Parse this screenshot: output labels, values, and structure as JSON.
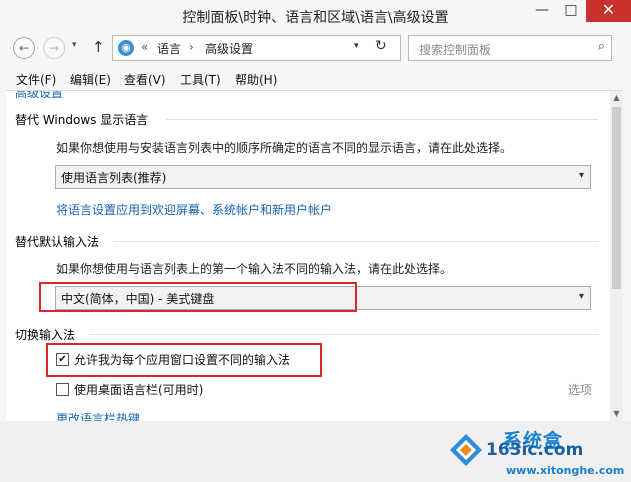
{
  "window": {
    "title": "控制面板\\时钟、语言和区域\\语言\\高级设置",
    "minimize": "—",
    "maximize": "□",
    "close": "✕"
  },
  "nav": {
    "back": "←",
    "forward": "→",
    "recent": "▾",
    "up": "↑",
    "address": {
      "sep1": "«",
      "crumb1": "语言",
      "sep2": "›",
      "crumb2": "高级设置",
      "dropdown": "▾",
      "refresh": "↻"
    },
    "search_placeholder": "搜索控制面板",
    "search_glyph": "⌕"
  },
  "menu": [
    "文件(F)",
    "编辑(E)",
    "查看(V)",
    "工具(T)",
    "帮助(H)"
  ],
  "content": {
    "cut_heading": "高级设置",
    "display_language": {
      "title": "替代 Windows 显示语言",
      "desc": "如果你想使用与安装语言列表中的顺序所确定的语言不同的显示语言，请在此处选择。",
      "select_value": "使用语言列表(推荐)",
      "link": "将语言设置应用到欢迎屏幕、系统帐户和新用户帐户"
    },
    "input_method": {
      "title": "替代默认输入法",
      "desc": "如果你想使用与语言列表上的第一个输入法不同的输入法，请在此处选择。",
      "select_value": "中文(简体，中国) - 美式键盘"
    },
    "switching": {
      "title": "切换输入法",
      "checkbox1": {
        "label": "允许我为每个应用窗口设置不同的输入法",
        "checked": true
      },
      "checkbox2": {
        "label": "使用桌面语言栏(可用时)",
        "checked": false
      },
      "options": "选项",
      "hotkey_link": "更改语言栏热键"
    },
    "arrow_glyph": "▾",
    "check_glyph": "✔"
  },
  "watermark": {
    "cn": "系统盒",
    "num": "163ic.com",
    "url": "www.xitonghe.com"
  },
  "colors": {
    "link": "#1a63b5",
    "highlight": "#d7282f",
    "close": "#c7302b"
  }
}
